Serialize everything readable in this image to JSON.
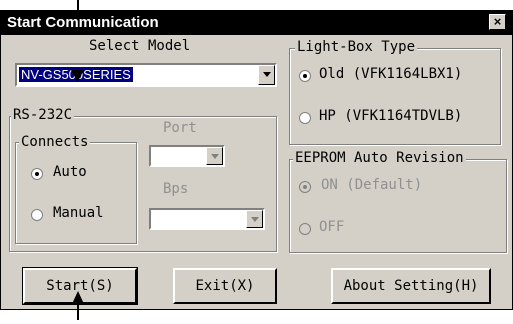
{
  "window": {
    "title": "Start Communication",
    "close_symbol": "×"
  },
  "select_model": {
    "label": "Select Model",
    "value": "NV-GS500SERIES"
  },
  "light_box": {
    "legend": "Light-Box Type",
    "options": [
      "Old (VFK1164LBX1)",
      "HP (VFK1164TDVLB)"
    ],
    "selected": 0
  },
  "rs232c": {
    "legend": "RS-232C",
    "connects_legend": "Connects",
    "connects_options": [
      "Auto",
      "Manual"
    ],
    "connects_selected": 0,
    "port_label": "Port",
    "bps_label": "Bps"
  },
  "eeprom": {
    "legend": "EEPROM Auto Revision",
    "options": [
      "ON (Default)",
      "OFF"
    ],
    "selected": 0
  },
  "buttons": {
    "start": "Start(S)",
    "exit": "Exit(X)",
    "about": "About Setting(H)"
  }
}
